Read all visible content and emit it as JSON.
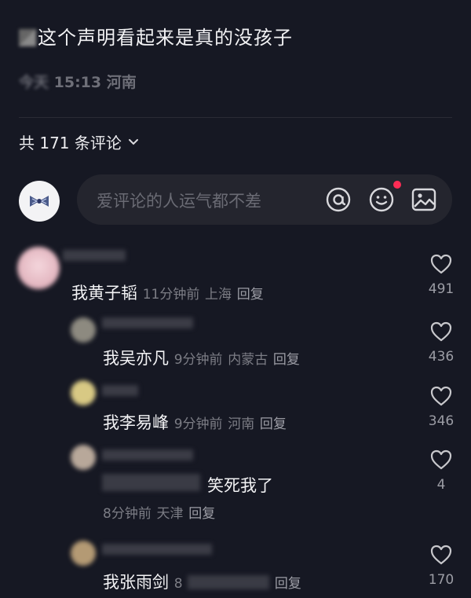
{
  "post": {
    "text": "这个声明看起来是真的没孩子",
    "time_prefix": "今天",
    "time": "15:13",
    "location": "河南"
  },
  "comments_header": {
    "label": "共 171 条评论"
  },
  "comment_input": {
    "placeholder": "爱评论的人运气都不差"
  },
  "comments": [
    {
      "body": "我黄子韬",
      "time": "11分钟前",
      "location": "上海",
      "reply": "回复",
      "likes": "491"
    },
    {
      "body": "我吴亦凡",
      "time": "9分钟前",
      "location": "内蒙古",
      "reply": "回复",
      "likes": "436"
    },
    {
      "body": "我李易峰",
      "time": "9分钟前",
      "location": "河南",
      "reply": "回复",
      "likes": "346"
    },
    {
      "body": "笑死我了",
      "time": "8分钟前",
      "location": "天津",
      "reply": "回复",
      "likes": "4"
    },
    {
      "body": "我张雨剑",
      "time": "8",
      "location": "",
      "reply": "回复",
      "likes": "170"
    }
  ],
  "colors": {
    "background": "#161823",
    "input_bg": "#24252e",
    "notification_dot": "#fe2c55"
  },
  "icons": [
    "chevron-down-icon",
    "at-icon",
    "emoji-icon",
    "image-icon",
    "heart-icon"
  ]
}
